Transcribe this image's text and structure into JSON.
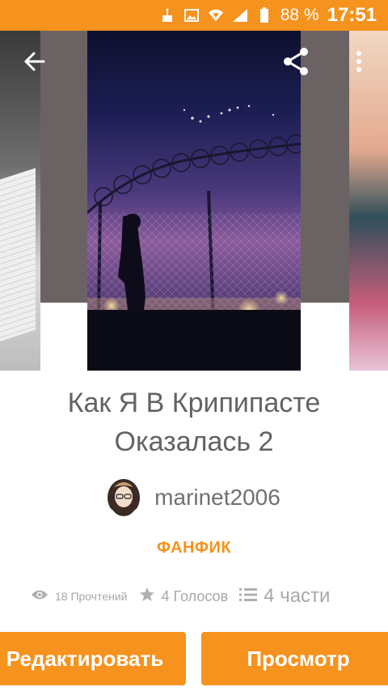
{
  "status_bar": {
    "battery_percent": "88 %",
    "time": "17:51",
    "icons": [
      "cake-icon",
      "image-icon",
      "wifi-icon",
      "signal-icon",
      "battery-icon"
    ]
  },
  "toolbar": {
    "back_icon": "arrow-left-icon",
    "share_icon": "share-icon",
    "more_icon": "more-vertical-icon"
  },
  "story": {
    "title_line1": "Как Я В Крипипасте",
    "title_line2": "Оказалась 2",
    "author": "marinet2006",
    "genre": "ФАНФИК",
    "reads": "18 Прочтений",
    "votes": "4 Голосов",
    "parts": "4 части"
  },
  "actions": {
    "edit_label": "Редактировать",
    "view_label": "Просмотр"
  },
  "colors": {
    "accent": "#f6921e",
    "text_primary": "#636363",
    "text_muted": "#a8a8a8"
  }
}
